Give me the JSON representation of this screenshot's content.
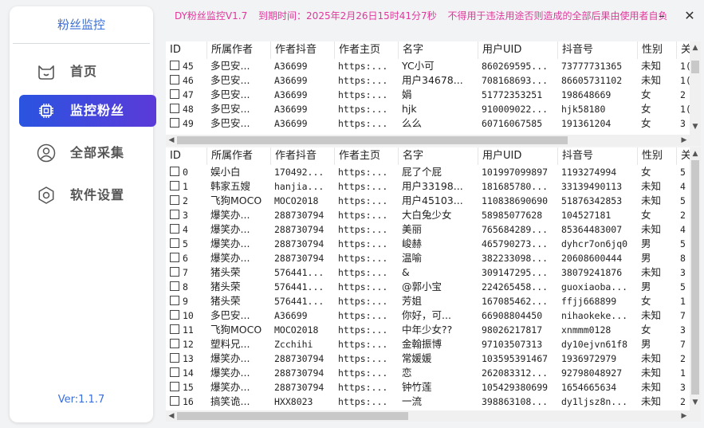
{
  "app": {
    "title": "粉丝监控",
    "version": "Ver:1.1.7",
    "notice": {
      "product": "DY粉丝监控V1.7",
      "expiry": "到期时间：2025年2月26日15时41分7秒",
      "warning": "不得用于违法用途否则造成的全部后果由使用者自负"
    },
    "minimize": "–",
    "close": "✕"
  },
  "sidebar": {
    "items": [
      {
        "label": "首页",
        "icon": "cat-face-icon",
        "active": false
      },
      {
        "label": "监控粉丝",
        "icon": "chip-icon",
        "active": true
      },
      {
        "label": "全部采集",
        "icon": "user-icon",
        "active": false
      },
      {
        "label": "软件设置",
        "icon": "gear-icon",
        "active": false
      }
    ]
  },
  "columns": [
    "ID",
    "所属作者",
    "作者抖音",
    "作者主页",
    "名字",
    "用户UID",
    "抖音号",
    "性别",
    "关"
  ],
  "top_table": {
    "rows": [
      [
        "45",
        "多巴安...",
        "A36699",
        "https:...",
        "YC小可",
        "860269595...",
        "73777731365",
        "未知",
        "1("
      ],
      [
        "46",
        "多巴安...",
        "A36699",
        "https:...",
        "用户34678...",
        "708168693...",
        "86605731102",
        "未知",
        "1("
      ],
      [
        "47",
        "多巴安...",
        "A36699",
        "https:...",
        "娟",
        "51772353251",
        "198648669",
        "女",
        "2"
      ],
      [
        "48",
        "多巴安...",
        "A36699",
        "https:...",
        "hjk",
        "910009022...",
        "hjk58180",
        "女",
        "1("
      ],
      [
        "49",
        "多巴安...",
        "A36699",
        "https:...",
        "么么",
        "60716067585",
        "191361204",
        "女",
        "3"
      ]
    ]
  },
  "bottom_table": {
    "rows": [
      [
        "0",
        "娱小白",
        "170492...",
        "https:...",
        "屁了个屁",
        "101997099897",
        "1193274994",
        "女",
        "5"
      ],
      [
        "1",
        "韩家五嫂",
        "hanjia...",
        "https:...",
        "用户33198...",
        "181685780...",
        "33139490113",
        "未知",
        "4"
      ],
      [
        "2",
        "飞狗MOCO",
        "MOCO2018",
        "https:...",
        "用户45103...",
        "110838690690",
        "51876342853",
        "未知",
        "5"
      ],
      [
        "3",
        "爆笑办...",
        "288730794",
        "https:...",
        "大白兔少女",
        "58985077628",
        "104527181",
        "女",
        "2"
      ],
      [
        "4",
        "爆笑办...",
        "288730794",
        "https:...",
        "美丽",
        "765684289...",
        "85364483007",
        "未知",
        "4"
      ],
      [
        "5",
        "爆笑办...",
        "288730794",
        "https:...",
        "峻赫",
        "465790273...",
        "dyhcr7on6jq0",
        "男",
        "5"
      ],
      [
        "6",
        "爆笑办...",
        "288730794",
        "https:...",
        "温喻",
        "382233098...",
        "20608600444",
        "男",
        "8"
      ],
      [
        "7",
        "猪头荣",
        "576441...",
        "https:...",
        "&",
        "309147295...",
        "38079241876",
        "未知",
        "3"
      ],
      [
        "8",
        "猪头荣",
        "576441...",
        "https:...",
        "@郭小宝",
        "224265458...",
        "guoxiaoba...",
        "男",
        "5"
      ],
      [
        "9",
        "猪头荣",
        "576441...",
        "https:...",
        "芳姐",
        "167085462...",
        "ffjj668899",
        "女",
        "1"
      ],
      [
        "10",
        "多巴安...",
        "A36699",
        "https:...",
        "你好，可...",
        "66908804450",
        "nihaokeke...",
        "未知",
        "7"
      ],
      [
        "11",
        "飞狗MOCO",
        "MOCO2018",
        "https:...",
        "中年少女??",
        "98026217817",
        "xnmmm0128",
        "女",
        "3"
      ],
      [
        "12",
        "塑料兄...",
        "Zcchihi",
        "https:...",
        "金翰振博",
        "97103507313",
        "dy10ejvn61f8",
        "男",
        "7"
      ],
      [
        "13",
        "爆笑办...",
        "288730794",
        "https:...",
        "常媛媛",
        "103595391467",
        "1936972979",
        "未知",
        "2"
      ],
      [
        "14",
        "爆笑办...",
        "288730794",
        "https:...",
        "恋",
        "262083312...",
        "92798048927",
        "未知",
        "1"
      ],
      [
        "15",
        "爆笑办...",
        "288730794",
        "https:...",
        "钟竹莲",
        "105429380699",
        "1654665634",
        "未知",
        "3"
      ],
      [
        "16",
        "搞笑诡...",
        "HXX8023",
        "https:...",
        "一流",
        "398863108...",
        "dy1ljsz8n...",
        "未知",
        "2"
      ]
    ]
  }
}
